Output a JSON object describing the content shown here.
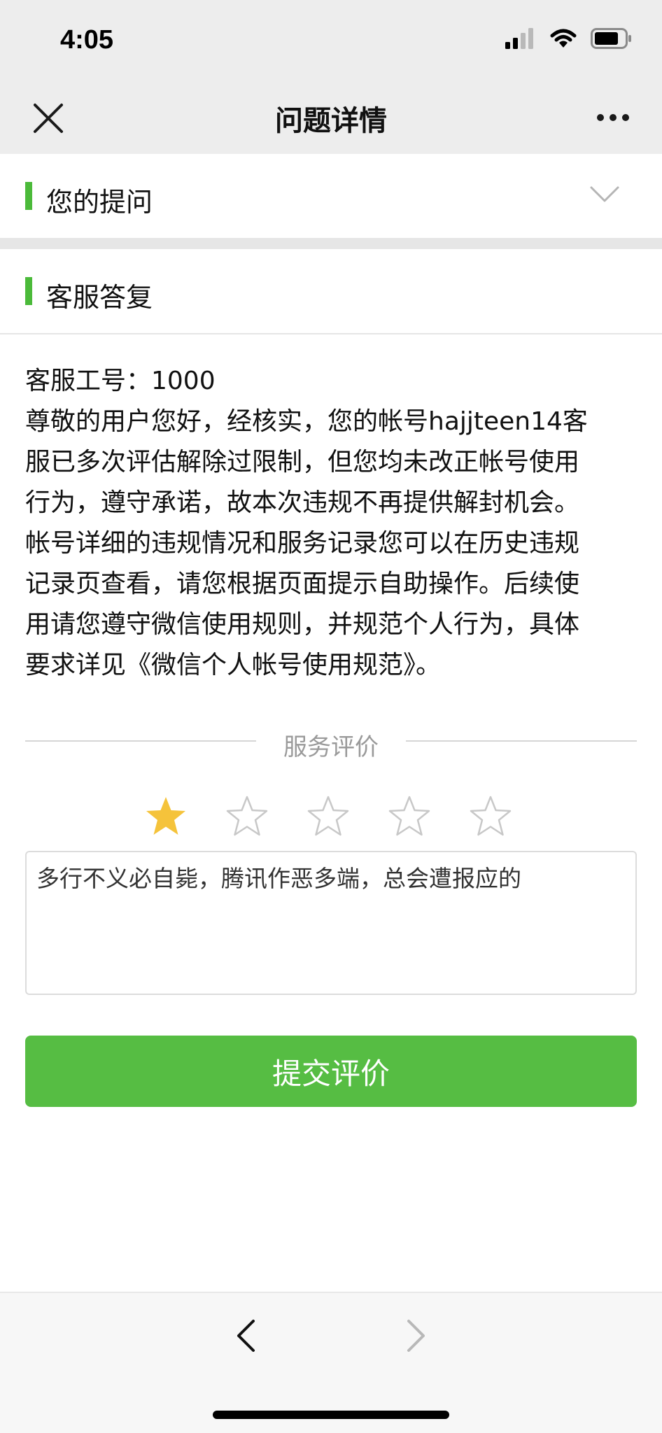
{
  "status_bar": {
    "time": "4:05"
  },
  "nav": {
    "title": "问题详情"
  },
  "question_section": {
    "title": "您的提问"
  },
  "answer_section": {
    "title": "客服答复",
    "lines": [
      "客服工号：1000",
      "尊敬的用户您好，经核实，您的帐号hajjteen14客",
      "服已多次评估解除过限制，但您均未改正帐号使用",
      "行为，遵守承诺，故本次违规不再提供解封机会。",
      "帐号详细的违规情况和服务记录您可以在历史违规",
      "记录页查看，请您根据页面提示自助操作。后续使",
      "用请您遵守微信使用规则，并规范个人行为，具体",
      "要求详见《微信个人帐号使用规范》。"
    ]
  },
  "rating": {
    "label": "服务评价",
    "stars_selected": 1,
    "stars_total": 5,
    "comment": "多行不义必自毙，腾讯作恶多端，总会遭报应的"
  },
  "submit_button": {
    "label": "提交评价"
  },
  "colors": {
    "accent": "#56bd43",
    "star_filled": "#f5c33b",
    "star_empty": "#c8c8c8"
  }
}
